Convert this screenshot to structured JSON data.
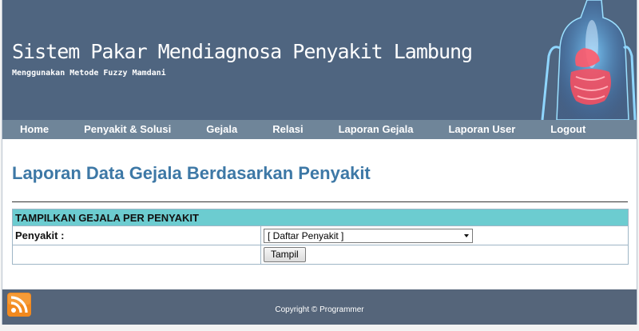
{
  "header": {
    "title": "Sistem Pakar Mendiagnosa Penyakit Lambung",
    "subtitle": "Menggunakan Metode Fuzzy Mamdani"
  },
  "nav": {
    "items": [
      "Home",
      "Penyakit & Solusi",
      "Gejala",
      "Relasi",
      "Laporan Gejala",
      "Laporan User",
      "Logout"
    ]
  },
  "main": {
    "title": "Laporan Data Gejala Berdasarkan Penyakit",
    "form": {
      "heading": "TAMPILKAN GEJALA PER PENYAKIT",
      "label": "Penyakit :",
      "select_value": "[ Daftar Penyakit ]",
      "button": "Tampil"
    }
  },
  "footer": {
    "copyright": "Copyright © Programmer",
    "icon": "rss-icon"
  },
  "colors": {
    "header_bg": "#4f6580",
    "nav_bg": "#6f8599",
    "title_color": "#3d78a6",
    "table_head_bg": "#6cccd0",
    "footer_bg": "#55657a"
  }
}
